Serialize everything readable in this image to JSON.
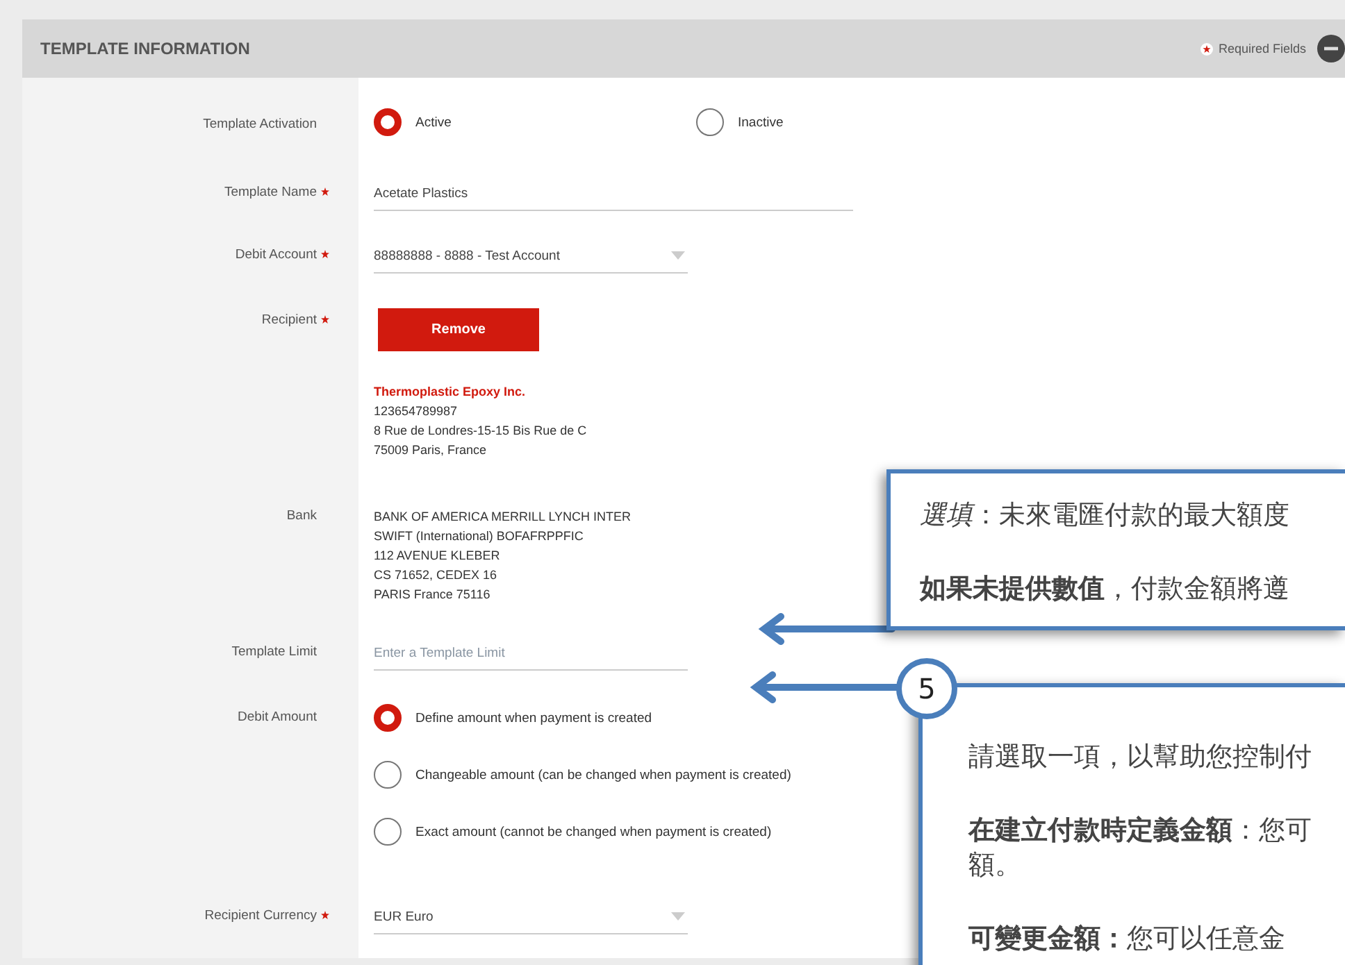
{
  "section": {
    "title": "TEMPLATE INFORMATION",
    "required_note": "Required Fields",
    "expanded": true
  },
  "fields": [
    {
      "kind": "radio",
      "label": "Template Activation",
      "required": false,
      "options": [
        {
          "label": "Active",
          "selected": true
        },
        {
          "label": "Inactive",
          "selected": false
        }
      ]
    },
    {
      "kind": "text",
      "label": "Template Name",
      "required": true,
      "value": "Acetate Plastics"
    },
    {
      "kind": "select",
      "label": "Debit Account",
      "required": true,
      "value": "88888888 - 8888 - Test Account"
    },
    {
      "kind": "recipient",
      "label": "Recipient",
      "required": true,
      "button": "Remove",
      "name": "Thermoplastic Epoxy Inc.",
      "lines": [
        "123654789987",
        "8 Rue de Londres-15-15 Bis Rue de C",
        "75009 Paris, France"
      ]
    },
    {
      "kind": "address",
      "label": "Bank",
      "required": false,
      "lines": [
        "BANK OF AMERICA MERRILL LYNCH INTER",
        "SWIFT (International) BOFAFRPPFIC",
        "112 AVENUE KLEBER",
        "CS 71652, CEDEX 16",
        "PARIS France 75116"
      ]
    },
    {
      "kind": "text",
      "label": "Template Limit",
      "required": false,
      "placeholder": "Enter a Template Limit"
    },
    {
      "kind": "radio-stack",
      "label": "Debit Amount",
      "required": false,
      "options": [
        {
          "label": "Define amount when payment is created",
          "selected": true
        },
        {
          "label": "Changeable amount (can be changed when payment is created)",
          "selected": false
        },
        {
          "label": "Exact amount (cannot be changed when payment is created)",
          "selected": false
        }
      ]
    },
    {
      "kind": "select",
      "label": "Recipient Currency",
      "required": true,
      "value": "EUR Euro"
    }
  ],
  "callouts": [
    {
      "paragraphs": [
        [
          "*選填*：未來電匯付款的最大額度"
        ],
        [
          "**如果未提供數值**，付款金額將遵"
        ]
      ]
    },
    {
      "number": "5",
      "paragraphs": [
        [
          "請選取一項，以幫助您控制付"
        ],
        [
          "**在建立付款時定義金額**：您可",
          "額。"
        ],
        [
          "**可變更金額：**您可以任意金"
        ]
      ]
    }
  ]
}
